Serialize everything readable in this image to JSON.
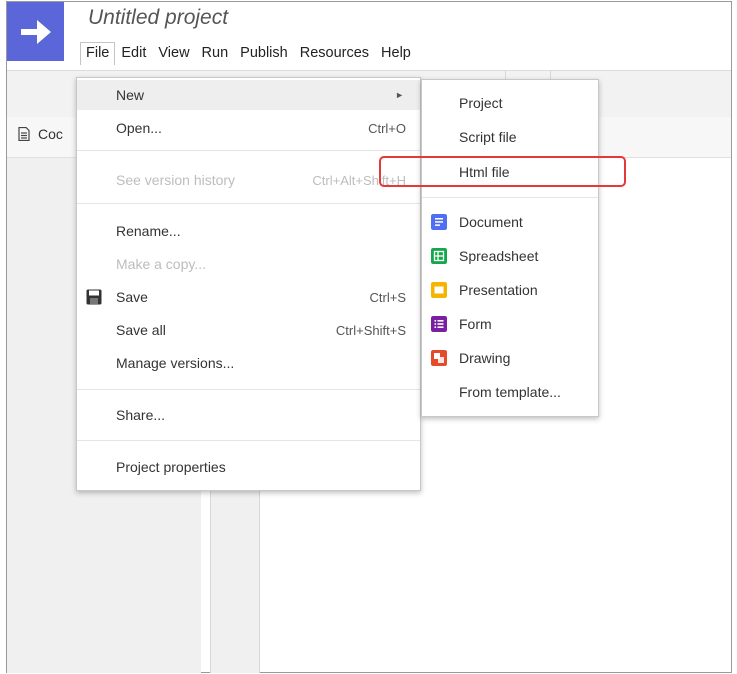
{
  "app": {
    "project_title": "Untitled project",
    "logo_icon": "arrow-right-icon",
    "brand_color": "#5b67d8"
  },
  "menubar": {
    "items": [
      {
        "label": "File",
        "open": true
      },
      {
        "label": "Edit"
      },
      {
        "label": "View"
      },
      {
        "label": "Run"
      },
      {
        "label": "Publish"
      },
      {
        "label": "Resources"
      },
      {
        "label": "Help"
      }
    ]
  },
  "tab": {
    "label": "Coc",
    "icon": "file-icon"
  },
  "file_menu": {
    "items": [
      {
        "label": "New",
        "submenu": true,
        "highlighted": true,
        "arrow": "►"
      },
      {
        "label": "Open...",
        "shortcut": "Ctrl+O"
      },
      {
        "label": "See version history",
        "shortcut": "Ctrl+Alt+Shift+H",
        "disabled": true
      },
      {
        "label": "Rename..."
      },
      {
        "label": "Make a copy...",
        "disabled": true
      },
      {
        "label": "Save",
        "shortcut": "Ctrl+S",
        "icon": "floppy-disk-icon"
      },
      {
        "label": "Save all",
        "shortcut": "Ctrl+Shift+S"
      },
      {
        "label": "Manage versions..."
      },
      {
        "label": "Share..."
      },
      {
        "label": "Project properties"
      }
    ]
  },
  "new_submenu": {
    "items": [
      {
        "label": "Project"
      },
      {
        "label": "Script file"
      },
      {
        "label": "Html file",
        "annotated": true
      },
      {
        "label": "Document",
        "icon": "docs-icon",
        "color": "#4f6ff0"
      },
      {
        "label": "Spreadsheet",
        "icon": "sheets-icon",
        "color": "#14a84d"
      },
      {
        "label": "Presentation",
        "icon": "slides-icon",
        "color": "#f4b400"
      },
      {
        "label": "Form",
        "icon": "forms-icon",
        "color": "#7b1fa2"
      },
      {
        "label": "Drawing",
        "icon": "drawings-icon",
        "color": "#e34b29"
      },
      {
        "label": "From template..."
      }
    ]
  },
  "annotation": {
    "color": "#e53935"
  }
}
